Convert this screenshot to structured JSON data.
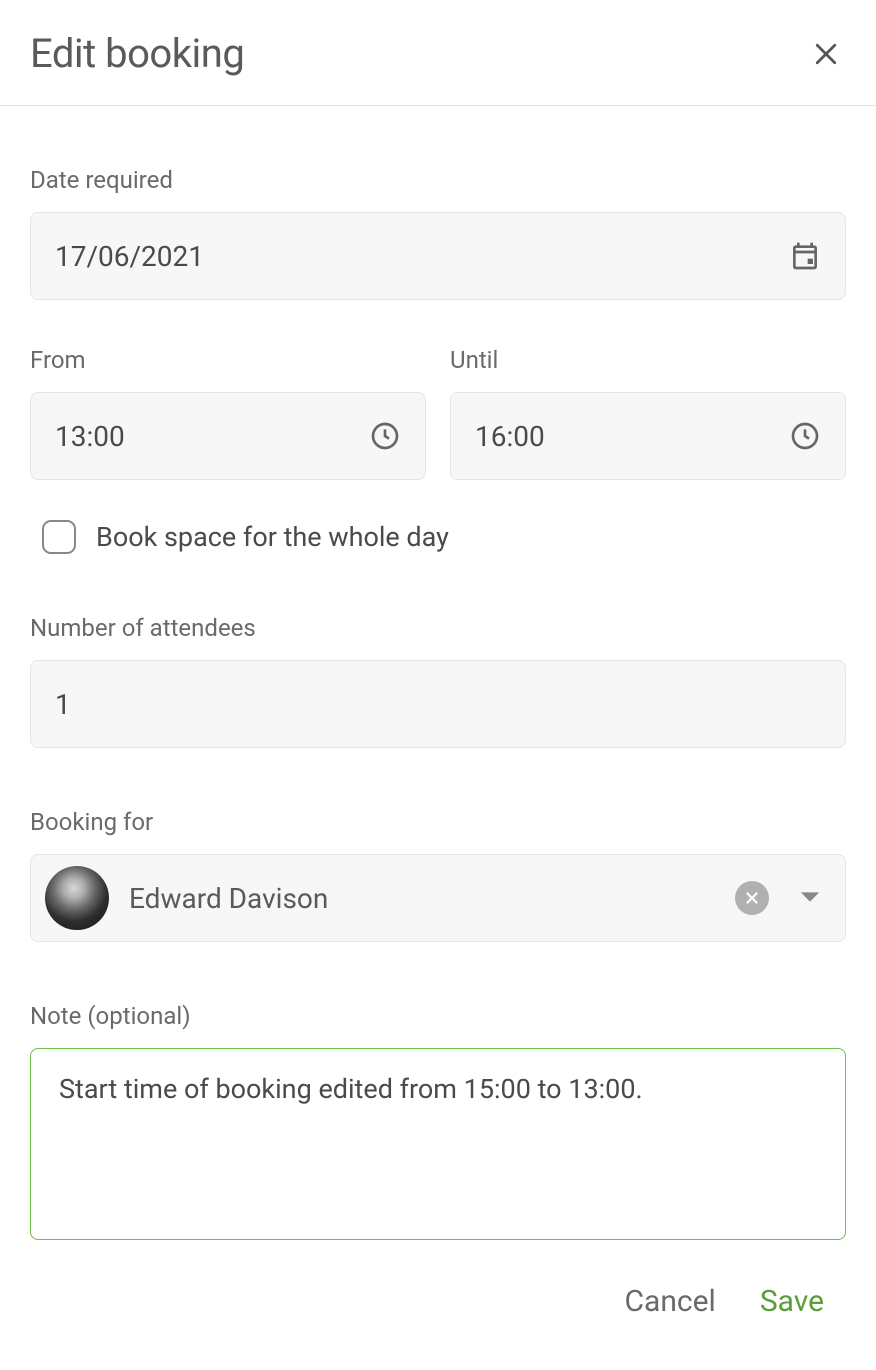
{
  "header": {
    "title": "Edit booking"
  },
  "form": {
    "date_label": "Date required",
    "date_value": "17/06/2021",
    "from_label": "From",
    "from_value": "13:00",
    "until_label": "Until",
    "until_value": "16:00",
    "whole_day_label": "Book space for the whole day",
    "whole_day_checked": false,
    "attendees_label": "Number of attendees",
    "attendees_value": "1",
    "booking_for_label": "Booking for",
    "booking_for_person": "Edward Davison",
    "note_label": "Note (optional)",
    "note_value": "Start time of booking edited from 15:00 to 13:00."
  },
  "footer": {
    "cancel_label": "Cancel",
    "save_label": "Save"
  },
  "colors": {
    "accent": "#6fbf4b",
    "save_text": "#5a9e3a"
  }
}
